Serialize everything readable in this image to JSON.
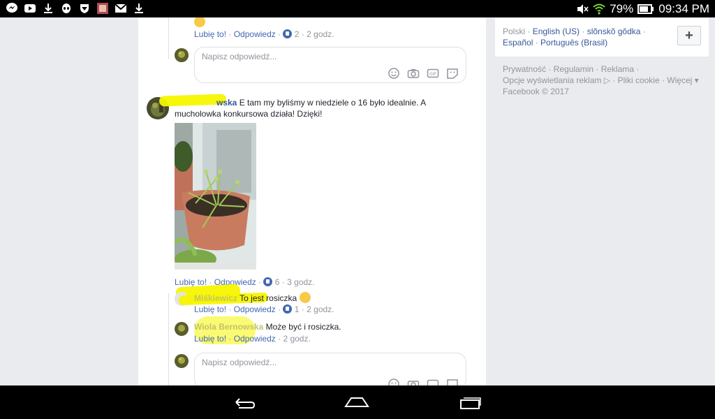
{
  "status": {
    "battery_percent": "79%",
    "time": "09:34 PM"
  },
  "comments": [
    {
      "like_label": "Lubię to!",
      "reply_label": "Odpowiedz",
      "like_count": "2",
      "time": "2 godz."
    },
    {
      "author_suffix": "wska",
      "text_line1": "E tam my byliśmy w niedziele o 16 było idealnie. A",
      "text_line2": "mucholowka konkursowa działa! Dzięki!",
      "like_label": "Lubię to!",
      "reply_label": "Odpowiedz",
      "like_count": "6",
      "time": "3 godz."
    },
    {
      "author": "Miśkiewicz",
      "text": "To jest rosiczka",
      "like_label": "Lubię to!",
      "reply_label": "Odpowiedz",
      "like_count": "1",
      "time": "2 godz."
    },
    {
      "author": "Wiola Bernowska",
      "text": "Może być i rosiczka.",
      "like_label": "Lubię to!",
      "reply_label": "Odpowiedz",
      "time": "2 godz."
    }
  ],
  "reply_placeholder": "Napisz odpowiedź...",
  "languages": {
    "current": "Polski",
    "others": [
      "English (US)",
      "slõnskõ gŏdka",
      "Español",
      "Português (Brasil)"
    ],
    "add_label": "+"
  },
  "footer": {
    "line1": "Prywatność · Regulamin · Reklama ·",
    "line2": "Opcje wyświetlania reklam ▷ · Pliki cookie · Więcej ▾",
    "line3": "Facebook © 2017"
  },
  "icons": {
    "status_left": [
      "messenger-icon",
      "youtube-icon",
      "download-icon",
      "alien-icon",
      "shield-icon",
      "photo-icon",
      "gmail-icon",
      "download-icon"
    ],
    "status_right": [
      "mute-icon",
      "wifi-icon",
      "battery-icon"
    ],
    "nav": [
      "back-icon",
      "home-icon",
      "recents-icon"
    ],
    "reply": [
      "emoji-icon",
      "camera-icon",
      "gif-icon",
      "sticker-icon"
    ]
  },
  "colors": {
    "link": "#365899",
    "accent": "#4267b2",
    "highlight": "#f7f500"
  }
}
